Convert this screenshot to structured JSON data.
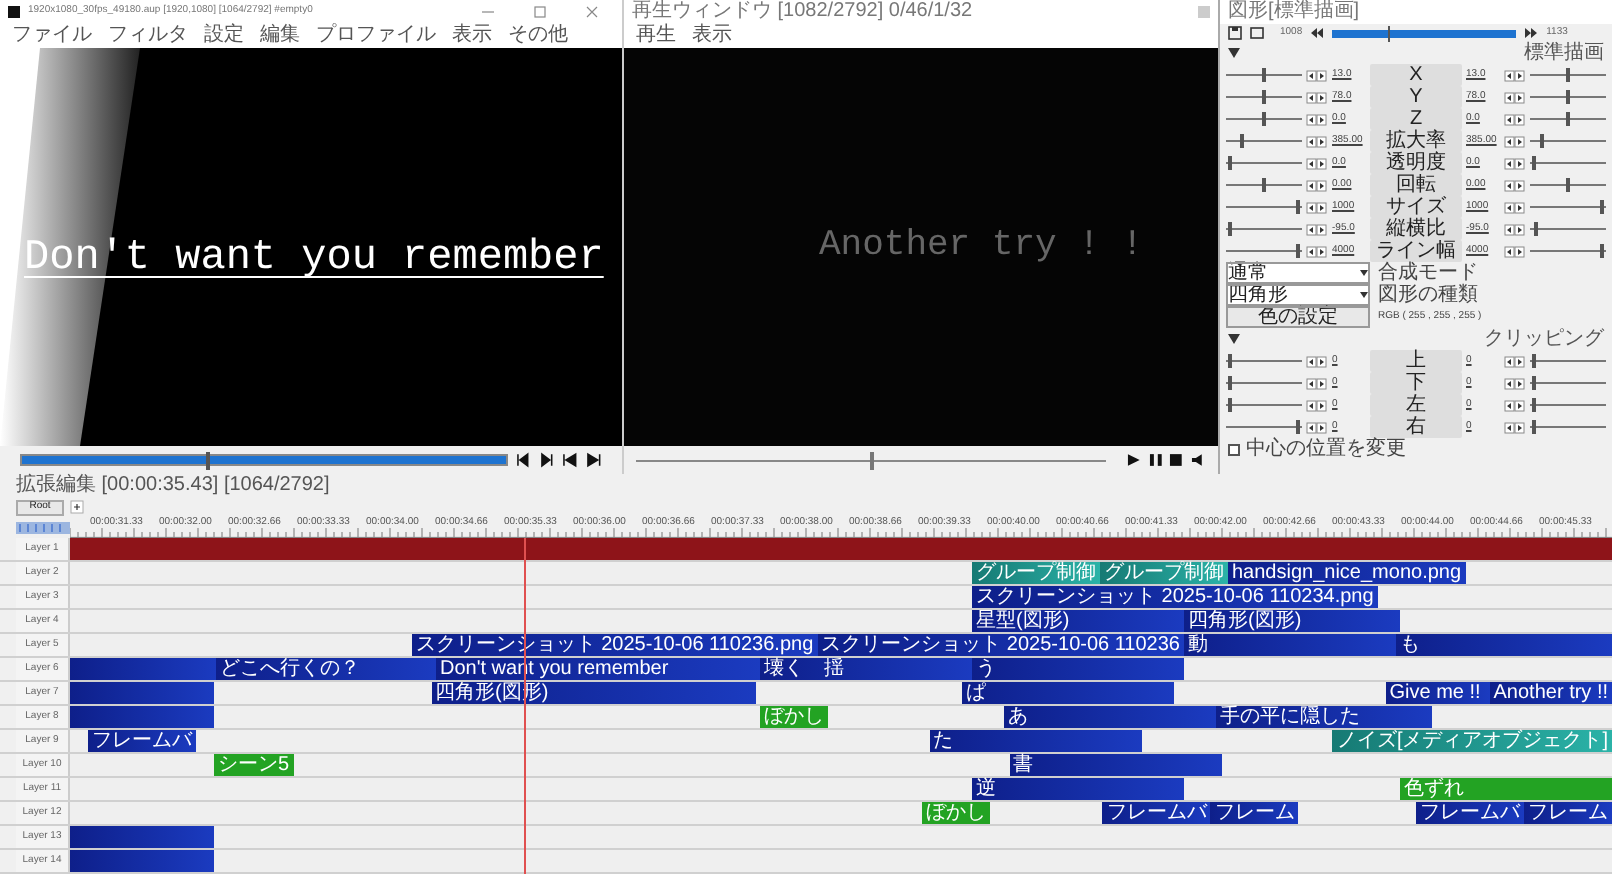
{
  "main_window": {
    "title": "1920x1080_30fps_49180.aup [1920,1080] [1064/2792] #empty0",
    "menu": [
      "ファイル",
      "フィルタ",
      "設定",
      "編集",
      "プロファイル",
      "表示",
      "その他"
    ],
    "preview_text": "Don't want you remember",
    "seek": {
      "level": 0.38
    }
  },
  "play_window": {
    "title": "再生ウィンドウ [1082/2792] 0/46/1/32",
    "menu": [
      "再生",
      "表示"
    ],
    "preview_text": "Another try ! !",
    "seek": {
      "level": 0.5
    }
  },
  "settings": {
    "title": "図形[標準描画]",
    "frame_start": "1008",
    "frame_end": "1133",
    "range": {
      "level": 0.3
    },
    "section_1": "標準描画",
    "params": [
      {
        "label": "X",
        "value_start": "13.0",
        "value_end": "13.0",
        "sliders": [
          {
            "level": 0.5
          },
          {
            "level": 0.5
          }
        ]
      },
      {
        "label": "Y",
        "value_start": "78.0",
        "value_end": "78.0",
        "sliders": [
          {
            "level": 0.5
          },
          {
            "level": 0.5
          }
        ]
      },
      {
        "label": "Z",
        "value_start": "0.0",
        "value_end": "0.0",
        "sliders": [
          {
            "level": 0.5
          },
          {
            "level": 0.5
          }
        ]
      },
      {
        "label": "拡大率",
        "value_start": "385.00",
        "value_end": "385.00",
        "sliders": [
          {
            "level": 0.2
          },
          {
            "level": 0.15
          }
        ]
      },
      {
        "label": "透明度",
        "value_start": "0.0",
        "value_end": "0.0",
        "sliders": [
          {
            "level": 0.02
          },
          {
            "level": 0.02
          }
        ]
      },
      {
        "label": "回転",
        "value_start": "0.00",
        "value_end": "0.00",
        "sliders": [
          {
            "level": 0.5
          },
          {
            "level": 0.5
          }
        ]
      },
      {
        "label": "サイズ",
        "value_start": "1000",
        "value_end": "1000",
        "sliders": [
          {
            "level": 0.97
          },
          {
            "level": 0.97
          }
        ]
      },
      {
        "label": "縦横比",
        "value_start": "-95.0",
        "value_end": "-95.0",
        "sliders": [
          {
            "level": 0.02
          },
          {
            "level": 0.05
          }
        ]
      },
      {
        "label": "ライン幅",
        "value_start": "4000",
        "value_end": "4000",
        "sliders": [
          {
            "level": 0.97
          },
          {
            "level": 0.97
          }
        ]
      }
    ],
    "blend_mode": {
      "value": "通常",
      "label": "合成モード"
    },
    "shape_type": {
      "value": "四角形",
      "label": "図形の種類"
    },
    "color_button": "色の設定",
    "color_value": "RGB ( 255 , 255 , 255 )",
    "section_2": "クリッピング",
    "clip_params": [
      {
        "label": "上",
        "value_start": "0",
        "value_end": "0",
        "sliders": [
          {
            "level": 0.02
          },
          {
            "level": 0.02
          }
        ]
      },
      {
        "label": "下",
        "value_start": "0",
        "value_end": "0",
        "sliders": [
          {
            "level": 0.02
          },
          {
            "level": 0.02
          }
        ]
      },
      {
        "label": "左",
        "value_start": "0",
        "value_end": "0",
        "sliders": [
          {
            "level": 0.02
          },
          {
            "level": 0.02
          }
        ]
      },
      {
        "label": "右",
        "value_start": "0",
        "value_end": "0",
        "sliders": [
          {
            "level": 0.97
          },
          {
            "level": 0.02
          }
        ]
      }
    ],
    "center_checkbox": {
      "label": "中心の位置を変更",
      "checked": false
    }
  },
  "timeline": {
    "title": "拡張編集 [00:00:35.43] [1064/2792]",
    "root_button": "Root",
    "ruler": [
      "00:00:31.33",
      "00:00:32.00",
      "00:00:32.66",
      "00:00:33.33",
      "00:00:34.00",
      "00:00:34.66",
      "00:00:35.33",
      "00:00:36.00",
      "00:00:36.66",
      "00:00:37.33",
      "00:00:38.00",
      "00:00:38.66",
      "00:00:39.33",
      "00:00:40.00",
      "00:00:40.66",
      "00:00:41.33",
      "00:00:42.00",
      "00:00:42.66",
      "00:00:43.33",
      "00:00:44.00",
      "00:00:44.66",
      "00:00:45.33"
    ],
    "layers": [
      {
        "label": "Layer 1",
        "clips": [
          {
            "kind": "audio"
          }
        ]
      },
      {
        "label": "Layer 2",
        "clips": [
          {
            "kind": "group",
            "text": "グループ制御"
          },
          {
            "kind": "group",
            "text": "グループ制御"
          },
          {
            "kind": "object",
            "text": "handsign_nice_mono.png"
          }
        ]
      },
      {
        "label": "Layer 3",
        "clips": [
          {
            "kind": "object",
            "text": "スクリーンショット 2025-10-06 110234.png"
          }
        ]
      },
      {
        "label": "Layer 4",
        "clips": [
          {
            "kind": "object",
            "text": "星型(図形)"
          },
          {
            "kind": "object",
            "text": "四角形(図形)"
          }
        ]
      },
      {
        "label": "Layer 5",
        "clips": [
          {
            "kind": "object",
            "text": "スクリーンショット 2025-10-06 110236.png"
          },
          {
            "kind": "object",
            "text": "スクリーンショット 2025-10-06 110236"
          },
          {
            "kind": "object",
            "text": "動"
          },
          {
            "kind": "object",
            "text": "も"
          }
        ]
      },
      {
        "label": "Layer 6",
        "clips": [
          {
            "kind": "object"
          },
          {
            "kind": "object",
            "text": "どこへ行くの？"
          },
          {
            "kind": "object",
            "text": "Don't want you remember"
          },
          {
            "kind": "object",
            "text": "壊く　揺"
          },
          {
            "kind": "object",
            "text": "う"
          }
        ]
      },
      {
        "label": "Layer 7",
        "clips": [
          {
            "kind": "object"
          },
          {
            "kind": "object",
            "text": "四角形(図形)"
          },
          {
            "kind": "object",
            "text": "ぱ"
          },
          {
            "kind": "object",
            "text": "Give me !!"
          },
          {
            "kind": "object",
            "text": "Another try !!"
          }
        ]
      },
      {
        "label": "Layer 8",
        "clips": [
          {
            "kind": "object"
          },
          {
            "kind": "filter",
            "text": "ぼかし"
          },
          {
            "kind": "object",
            "text": "あ"
          },
          {
            "kind": "object",
            "text": "手の平に隠した"
          }
        ]
      },
      {
        "label": "Layer 9",
        "clips": [
          {
            "kind": "object",
            "text": "フレームバ"
          },
          {
            "kind": "object",
            "text": "た"
          },
          {
            "kind": "group",
            "text": "ノイズ[メディアオブジェクト]"
          }
        ]
      },
      {
        "label": "Layer 10",
        "clips": [
          {
            "kind": "filter",
            "text": "シーン5"
          },
          {
            "kind": "object",
            "text": "書"
          }
        ]
      },
      {
        "label": "Layer 11",
        "clips": [
          {
            "kind": "object",
            "text": "逆"
          },
          {
            "kind": "filter",
            "text": "色ずれ"
          }
        ]
      },
      {
        "label": "Layer 12",
        "clips": [
          {
            "kind": "filter",
            "text": "ぼかし"
          },
          {
            "kind": "object",
            "text": "フレームバ"
          },
          {
            "kind": "object",
            "text": "フレーム"
          },
          {
            "kind": "object",
            "text": "フレームバ"
          },
          {
            "kind": "object",
            "text": "フレーム"
          }
        ]
      },
      {
        "label": "Layer 13",
        "clips": [
          {
            "kind": "object"
          }
        ]
      },
      {
        "label": "Layer 14",
        "clips": [
          {
            "kind": "object"
          }
        ]
      }
    ]
  }
}
